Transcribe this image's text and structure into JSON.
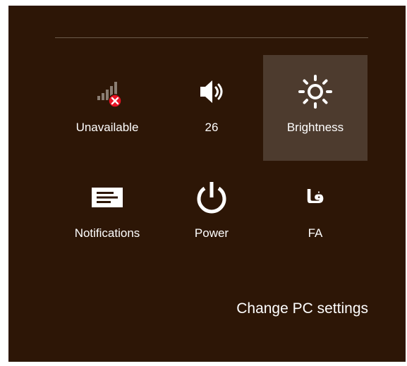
{
  "colors": {
    "panel_bg": "#2d1606",
    "selected_tile_bg": "#4d3b2e",
    "divider": "#6b5a4a",
    "text": "#ffffff",
    "error_badge": "#e81123"
  },
  "tiles": [
    {
      "label": "Unavailable",
      "icon": "network-unavailable-icon"
    },
    {
      "label": "26",
      "icon": "volume-icon"
    },
    {
      "label": "Brightness",
      "icon": "brightness-icon",
      "selected": true
    },
    {
      "label": "Notifications",
      "icon": "notifications-icon"
    },
    {
      "label": "Power",
      "icon": "power-icon"
    },
    {
      "label": "FA",
      "icon": "keyboard-language-icon",
      "glyph": "فا"
    }
  ],
  "change_pc_settings": "Change PC settings"
}
